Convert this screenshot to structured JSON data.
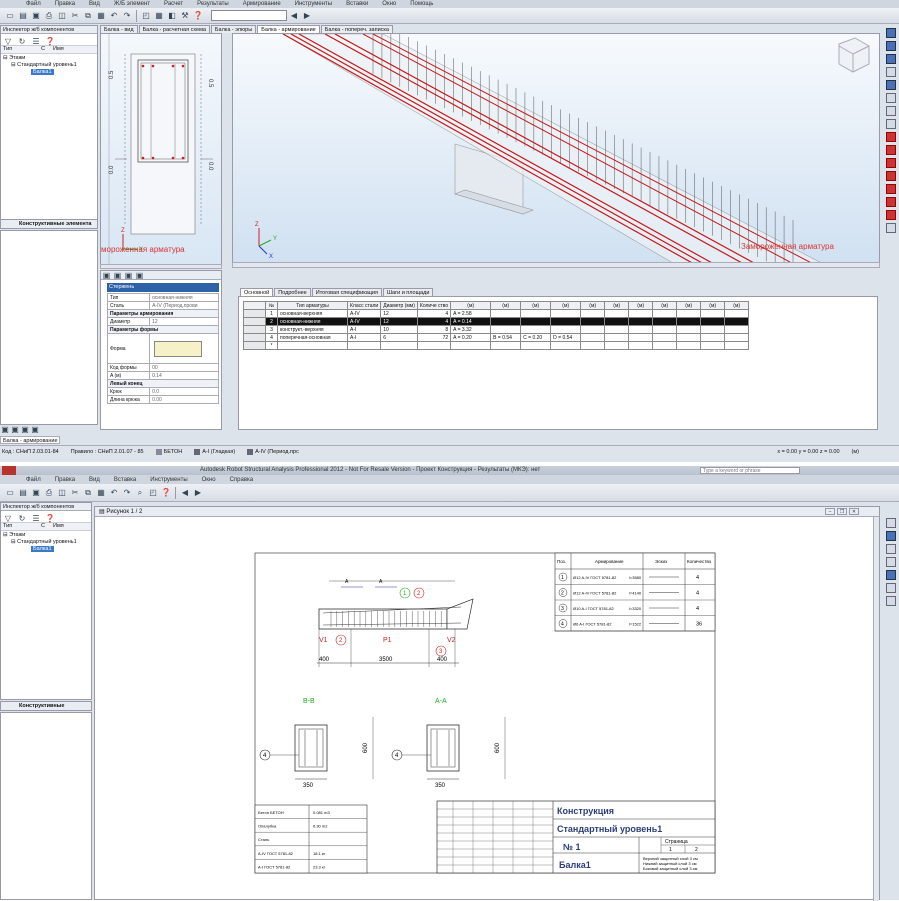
{
  "w1": {
    "menu": [
      "Файл",
      "Правка",
      "Вид",
      "Ж/Б элемент",
      "Расчет",
      "Результаты",
      "Армирование",
      "Инструменты",
      "Вставки",
      "Окно",
      "Помощь"
    ],
    "inspector": "Инспектор ж/б компонентов",
    "tree_head": [
      "Тип",
      "С",
      "Имя"
    ],
    "tree": [
      "Этажи",
      "Стандартный уровень1",
      "Балка1"
    ],
    "konstr": "Конструктивные элемента",
    "tabs": [
      "Балка - вид",
      "Балка - расчетная схема",
      "Балка - эпюры",
      "Балка - армирование",
      "Балка - попереч. записка"
    ],
    "frozen_left": "мороженная арматура",
    "frozen_right": "Замороженная арматура",
    "axis_vals": [
      "0.5",
      "0.0",
      "-0.5",
      "0.5",
      "0.0"
    ],
    "props": {
      "title": "Стержень",
      "rows": [
        {
          "k": "Тип",
          "v": "основная-нижняя"
        },
        {
          "k": "Сталь",
          "v": "A-IV (Период.прови"
        },
        {
          "k": "Параметры армирования",
          "v": "",
          "h": true
        },
        {
          "k": "Диаметр",
          "v": "12"
        },
        {
          "k": "Параметры формы",
          "v": "",
          "h": true
        },
        {
          "k": "Форма",
          "v": ""
        },
        {
          "k": "Код формы",
          "v": "00"
        },
        {
          "k": "A (м)",
          "v": "0.14"
        },
        {
          "k": "Левый конец",
          "v": "",
          "h": true
        },
        {
          "k": "Крюк",
          "v": "0.0"
        },
        {
          "k": "Длина крюка",
          "v": "0.00"
        }
      ]
    },
    "bottom_tabs": [
      "Основной",
      "Подробнее",
      "Итоговая спецификация",
      "Шаги и площади"
    ],
    "table": {
      "head": [
        "№",
        "Тип арматуры",
        "Класс стали",
        "Диаметр (мм)",
        "Количе ство",
        "(м)",
        "(м)",
        "(м)",
        "(м)",
        "(м)",
        "(м)",
        "(м)",
        "(м)",
        "(м)",
        "(м)",
        "(м)"
      ],
      "rows": [
        [
          "1",
          "основная-верхняя",
          "A-IV",
          "12",
          "4",
          "A = 2.58",
          "",
          "",
          "",
          "",
          "",
          "",
          "",
          "",
          "",
          ""
        ],
        [
          "2",
          "основная-нижняя",
          "A-IV",
          "12",
          "4",
          "A = 0.14",
          "",
          "",
          "",
          "",
          "",
          "",
          "",
          "",
          "",
          ""
        ],
        [
          "3",
          "конструкт.-верхняя",
          "A-I",
          "10",
          "8",
          "A = 3.32",
          "",
          "",
          "",
          "",
          "",
          "",
          "",
          "",
          "",
          ""
        ],
        [
          "4",
          "поперечная-основная",
          "A-I",
          "6",
          "72",
          "A = 0.20",
          "B = 0.54",
          "C = 0.20",
          "D = 0.54",
          "",
          "",
          "",
          "",
          "",
          "",
          ""
        ],
        [
          "*",
          "",
          "",
          "",
          "",
          "",
          "",
          "",
          "",
          "",
          "",
          "",
          "",
          "",
          "",
          ""
        ]
      ]
    },
    "bottom_label": "Балка - армирование",
    "status": {
      "code": "Код : СНиП 2.03.01-84",
      "rule": "Правило : СНиП 2.01.07 - 85",
      "mat": "БЕТОН",
      "steel1": "A-I (Гладкая)",
      "steel2": "A-IV (Период.прс",
      "coords": "x = 0.00 y = 0.00 z = 0.00",
      "unit": "(м)"
    }
  },
  "w2": {
    "title": "Autodesk Robot Structural Analysis Professional 2012 - Not For Resale Version - Проект Конструкция - Результаты (МКЭ): нет",
    "keyword": "Type a keyword or phrase",
    "menu": [
      "Файл",
      "Правка",
      "Вид",
      "Вставка",
      "Инструменты",
      "Окно",
      "Справка"
    ],
    "inspector": "Инспектор ж/б компонентов",
    "tree_head": [
      "Тип",
      "С",
      "Имя"
    ],
    "tree": [
      "Этажи",
      "Стандартный уровень1",
      "Балка1"
    ],
    "konstr": "Конструктивные элемента",
    "doc_title": "Рисунок 1 / 2",
    "drawing": {
      "dims": [
        "400",
        "3500",
        "400",
        "350",
        "350",
        "600",
        "600"
      ],
      "labels": [
        "P1",
        "V1",
        "V2",
        "B-B",
        "A-A",
        "A",
        "A"
      ],
      "callouts": [
        "1",
        "2",
        "3",
        "2",
        "3",
        "4",
        "4"
      ]
    },
    "spec": {
      "head": [
        "Поз.",
        "Армирование",
        "Эскиз",
        "Количество"
      ],
      "rows": [
        {
          "n": "1",
          "a": "Ø12 A-IV ГОСТ 5781-82",
          "l": "l=3580",
          "q": "4"
        },
        {
          "n": "2",
          "a": "Ø12 A-IV ГОСТ 5781-82",
          "l": "l=4140",
          "q": "4"
        },
        {
          "n": "3",
          "a": "Ø10 A-I ГОСТ 5781-82",
          "l": "l=3320",
          "q": "4"
        },
        {
          "n": "4",
          "a": "Ø6 A-I ГОСТ 5781-82",
          "l": "l=1522",
          "q": "36"
        }
      ]
    },
    "materials": [
      {
        "k": "Бетон БЕТОН",
        "v": "0.081 m3"
      },
      {
        "k": "Опалубка",
        "v": "0.30 m2"
      },
      {
        "k": "Сталь",
        "v": ""
      },
      {
        "k": "A-IV ГОСТ 5781-82",
        "v": "18.1 кг"
      },
      {
        "k": "A-I ГОСТ 5781-82",
        "v": "23.3 кг"
      }
    ],
    "stamp": {
      "t1": "Конструкция",
      "t2": "Стандартный уровень1",
      "num": "№ 1",
      "name": "Балка1",
      "page": "Страница",
      "p1": "1",
      "p2": "2",
      "n1": "Верхний защитный слой 3 см",
      "n2": "Нижний защитный слой 3 см",
      "n3": "Боковой защитный слой 3 см"
    }
  }
}
